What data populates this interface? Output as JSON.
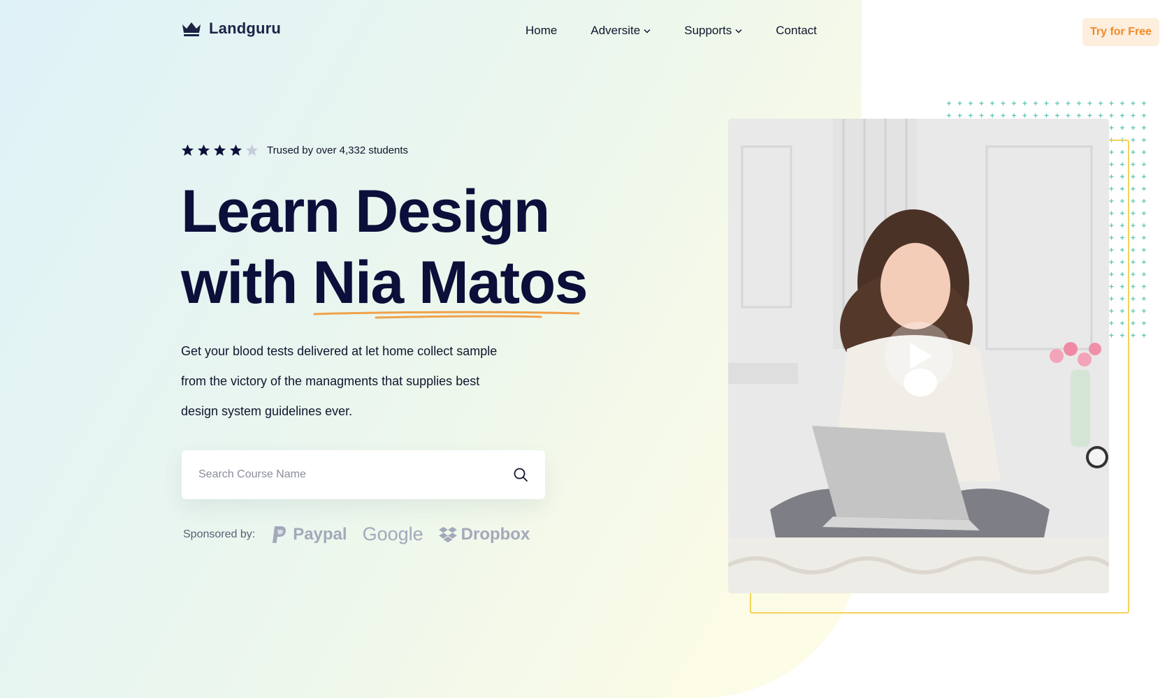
{
  "header": {
    "logo_text": "Landguru",
    "nav": [
      {
        "label": "Home"
      },
      {
        "label": "Adversite"
      },
      {
        "label": "Supports"
      },
      {
        "label": "Contact"
      }
    ],
    "cta_label": "Try for Free"
  },
  "hero": {
    "rating": {
      "stars_filled": 4,
      "stars_total": 5,
      "text": "Trused by over 4,332 students"
    },
    "title_line1": "Learn Design",
    "title_line2_prefix": "with ",
    "title_line2_highlight": "Nia Matos",
    "description_lines": [
      "Get your blood tests delivered at let home collect sample",
      "from the victory of the managments that supplies best",
      "design system guidelines ever."
    ],
    "search": {
      "placeholder": "Search Course Name",
      "value": ""
    },
    "sponsors": {
      "label": "Sponsored by:",
      "brands": [
        "Paypal",
        "Google",
        "Dropbox"
      ]
    }
  },
  "colors": {
    "accent_orange": "#f08a2a",
    "navy": "#0b0f3a",
    "frame_yellow": "#f3d35a",
    "dots_teal": "#5ec5b8"
  },
  "icons": {
    "logo": "crown-icon",
    "dropdown": "chevron-down-icon",
    "search": "search-icon",
    "play": "play-icon"
  }
}
